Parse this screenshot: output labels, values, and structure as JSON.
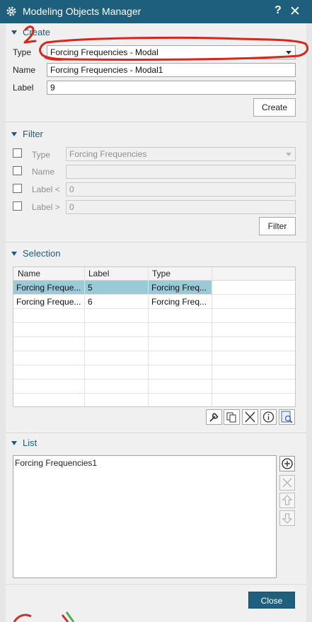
{
  "window": {
    "title": "Modeling Objects Manager",
    "help_glyph": "?",
    "close_glyph": "✕"
  },
  "create": {
    "heading": "Create",
    "type_label": "Type",
    "type_value": "Forcing Frequencies - Modal",
    "name_label": "Name",
    "name_value": "Forcing Frequencies - Modal1",
    "label_label": "Label",
    "label_value": "9",
    "create_button": "Create"
  },
  "filter": {
    "heading": "Filter",
    "type_label": "Type",
    "type_value": "Forcing Frequencies",
    "name_label": "Name",
    "name_value": "",
    "label_lt": "Label <",
    "label_lt_value": "0",
    "label_gt": "Label >",
    "label_gt_value": "0",
    "filter_button": "Filter"
  },
  "selection": {
    "heading": "Selection",
    "columns": [
      "Name",
      "Label",
      "Type"
    ],
    "rows": [
      {
        "name": "Forcing Freque...",
        "label": "5",
        "type": "Forcing Freq...",
        "selected": true
      },
      {
        "name": "Forcing Freque...",
        "label": "6",
        "type": "Forcing Freq...",
        "selected": false
      }
    ],
    "selected_color": "#9ac9d8",
    "tools": [
      "wrench-icon",
      "copy-icon",
      "delete-icon",
      "info-icon",
      "zoom-page-icon"
    ]
  },
  "list": {
    "heading": "List",
    "items": [
      "Forcing Frequencies1"
    ],
    "side_buttons": [
      "add-icon",
      "remove-icon",
      "move-up-icon",
      "move-down-icon"
    ]
  },
  "footer": {
    "close_button": "Close"
  },
  "annotation": {
    "marker_text": "2",
    "color": "#d9261c"
  },
  "colors": {
    "titlebar": "#1e5f7d",
    "accent": "#1a5c7f"
  }
}
